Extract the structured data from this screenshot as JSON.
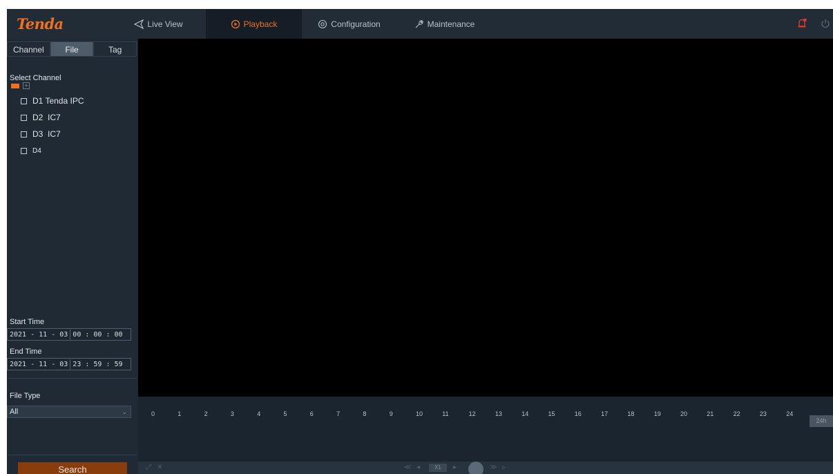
{
  "header": {
    "logo": "Tenda",
    "tabs": [
      {
        "label": "Live View",
        "icon": "live-view-icon"
      },
      {
        "label": "Playback",
        "icon": "playback-icon"
      },
      {
        "label": "Configuration",
        "icon": "configuration-icon"
      },
      {
        "label": "Maintenance",
        "icon": "maintenance-icon"
      }
    ],
    "active_tab": "Playback",
    "right_icons": [
      "alarm-bell-icon",
      "power-icon"
    ]
  },
  "sidebar": {
    "subtabs": [
      "Channel",
      "File",
      "Tag"
    ],
    "active_subtab": "File",
    "select_channel_label": "Select Channel",
    "channels": [
      {
        "label": "D1 Tenda IPC"
      },
      {
        "label": "D2  IC7"
      },
      {
        "label": "D3  IC7"
      },
      {
        "label": "D4"
      }
    ],
    "start_time_label": "Start Time",
    "start_date": "2021 - 11 - 03",
    "start_time": "00 : 00 : 00",
    "end_time_label": "End Time",
    "end_date": "2021 - 11 - 03",
    "end_time": "23 : 59 : 59",
    "file_type_label": "File Type",
    "file_type_value": "All",
    "search_label": "Search"
  },
  "timeline": {
    "hours": [
      "0",
      "1",
      "2",
      "3",
      "4",
      "5",
      "6",
      "7",
      "8",
      "9",
      "10",
      "11",
      "12",
      "13",
      "14",
      "15",
      "16",
      "17",
      "18",
      "19",
      "20",
      "21",
      "22",
      "23",
      "24"
    ],
    "range_label": "24h"
  },
  "controls": {
    "speed_label": "X1"
  },
  "colors": {
    "accent": "#f0701e",
    "header_bg": "#212c37",
    "panel_bg": "#1f2a35",
    "video_bg": "#000000",
    "search_button": "#8a3d0c"
  }
}
